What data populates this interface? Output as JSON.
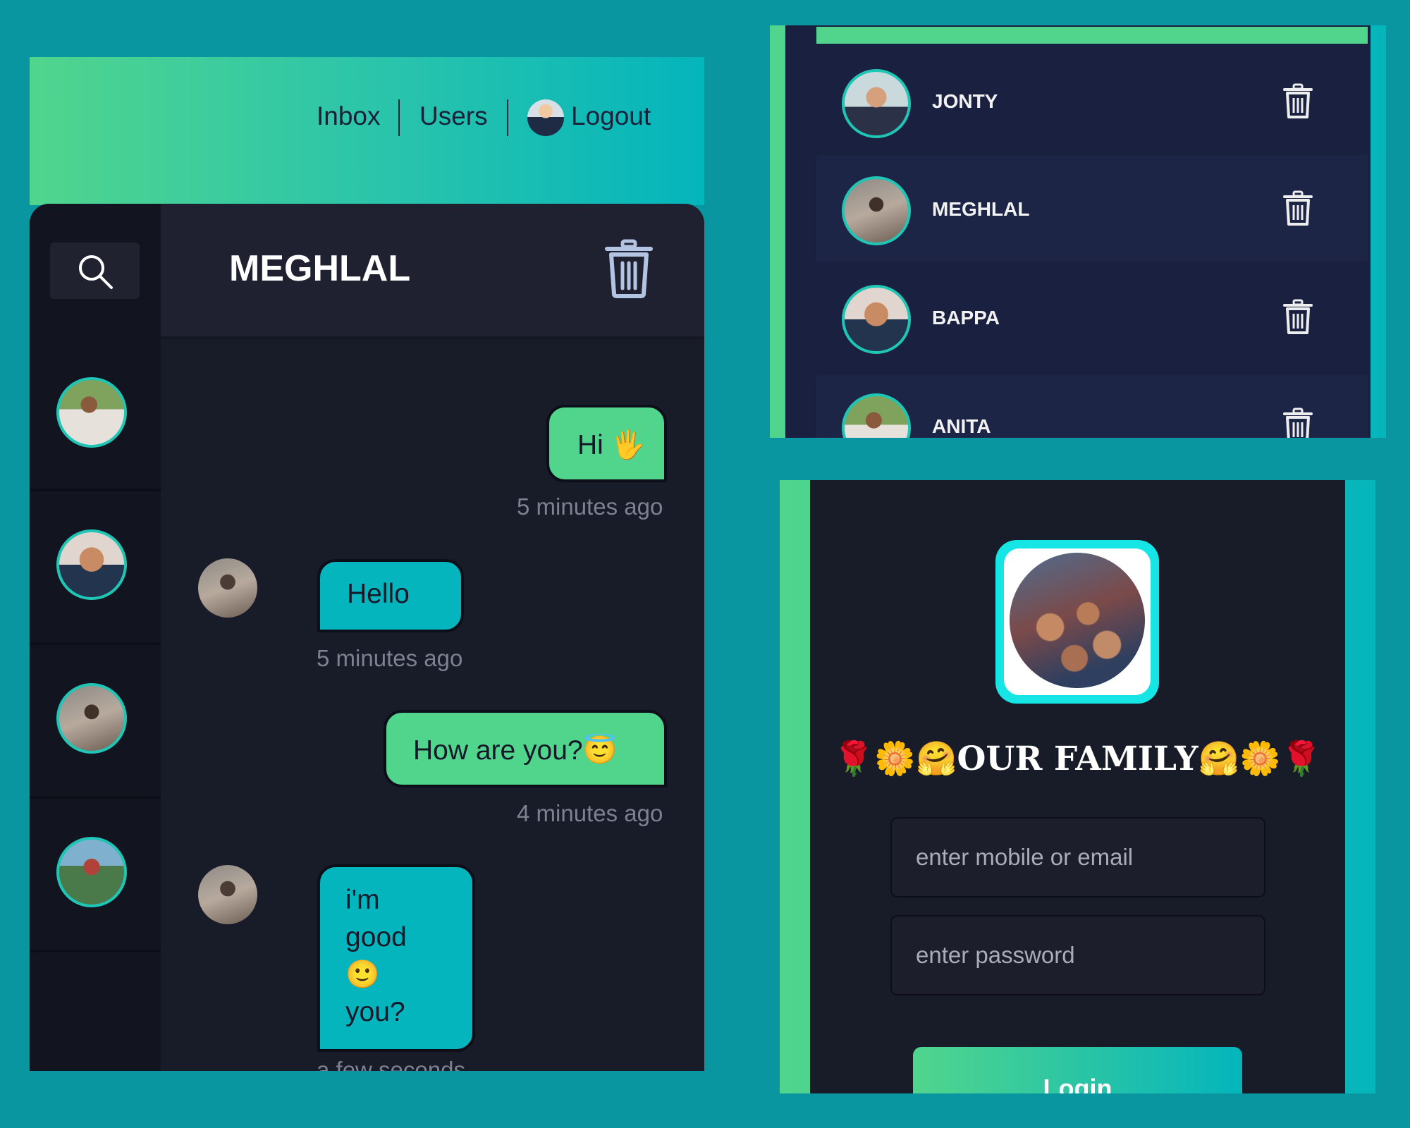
{
  "chat": {
    "nav": {
      "inbox": "Inbox",
      "users": "Users",
      "logout": "Logout"
    },
    "conversation_title": "MEGHLAL",
    "messages": [
      {
        "text": "Hi 🖐",
        "time": "5 minutes ago",
        "direction": "outgoing"
      },
      {
        "text": "Hello",
        "time": "5 minutes ago",
        "direction": "incoming"
      },
      {
        "text": "How are you?😇",
        "time": "4 minutes ago",
        "direction": "outgoing"
      },
      {
        "text_lines": [
          "i'm",
          "good",
          "🙂",
          "you?"
        ],
        "time": "a few seconds",
        "direction": "incoming"
      }
    ]
  },
  "users": [
    {
      "name": "JONTY"
    },
    {
      "name": "MEGHLAL"
    },
    {
      "name": "BAPPA"
    },
    {
      "name": "ANITA"
    }
  ],
  "login": {
    "title": "🌹🌼🤗OUR FAMILY🤗🌼🌹",
    "identifier_placeholder": "enter mobile or email",
    "password_placeholder": "enter password",
    "button_label": "Login"
  },
  "colors": {
    "page_background": "#0a96a0",
    "accent_green": "#51d58d",
    "accent_teal": "#04b5bc",
    "dark_surface": "#181b28",
    "users_surface": "#1a2140"
  }
}
